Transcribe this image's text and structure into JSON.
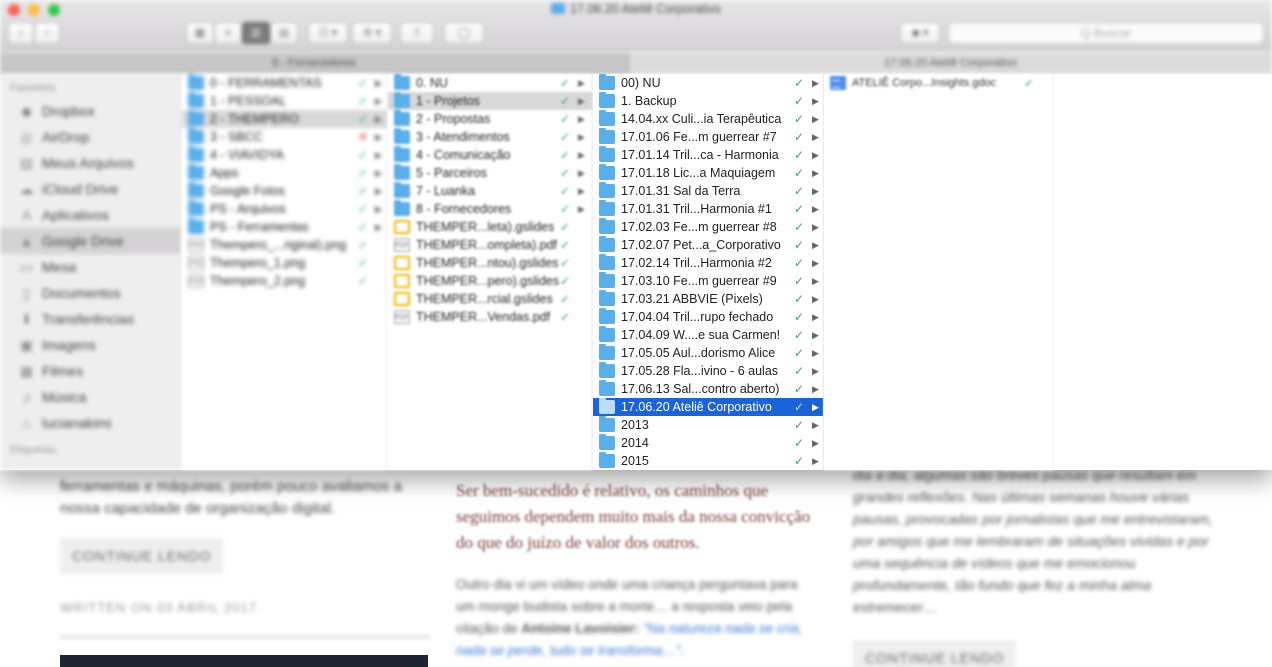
{
  "window": {
    "title": "17.06.20 Ateliê Corporativo"
  },
  "toolbar": {
    "back": "‹",
    "forward": "›",
    "view_icons": "▦",
    "view_list": "≡",
    "view_columns": "▥",
    "view_coverflow": "▤",
    "arrange": "☷ ▾",
    "action": "⚙ ▾",
    "share": "⇧",
    "tags": "◯",
    "dropbox": "◆ ▾",
    "search_placeholder": "Q Buscar"
  },
  "pathbar": {
    "left": "8 - Fornecedores",
    "right": "17.06.20 Ateliê Corporativo"
  },
  "sidebar": {
    "favorites_heading": "Favoritos",
    "tags_heading": "Etiquetas",
    "items": [
      {
        "label": "Dropbox",
        "icon": "dropbox-icon",
        "glyph": "◆"
      },
      {
        "label": "AirDrop",
        "icon": "airdrop-icon",
        "glyph": "◎"
      },
      {
        "label": "Meus Arquivos",
        "icon": "all-files-icon",
        "glyph": "▤"
      },
      {
        "label": "iCloud Drive",
        "icon": "cloud-icon",
        "glyph": "☁"
      },
      {
        "label": "Aplicativos",
        "icon": "applications-icon",
        "glyph": "A"
      },
      {
        "label": "Google Drive",
        "icon": "google-drive-icon",
        "glyph": "▲"
      },
      {
        "label": "Mesa",
        "icon": "desktop-icon",
        "glyph": "▭"
      },
      {
        "label": "Documentos",
        "icon": "documents-icon",
        "glyph": "▯"
      },
      {
        "label": "Transferências",
        "icon": "downloads-icon",
        "glyph": "⬇"
      },
      {
        "label": "Imagens",
        "icon": "pictures-icon",
        "glyph": "▣"
      },
      {
        "label": "Filmes",
        "icon": "movies-icon",
        "glyph": "▦"
      },
      {
        "label": "Música",
        "icon": "music-icon",
        "glyph": "♫"
      },
      {
        "label": "lucianakimi",
        "icon": "home-icon",
        "glyph": "⌂"
      }
    ]
  },
  "columns": {
    "col1": [
      {
        "label": "0 - FERRAMENTAS",
        "type": "folder",
        "status": "ok",
        "arrow": true
      },
      {
        "label": "1 - PESSOAL",
        "type": "folder",
        "status": "ok",
        "arrow": true
      },
      {
        "label": "2 - THEMPERO",
        "type": "folder",
        "status": "ok",
        "arrow": true
      },
      {
        "label": "3 - SBCC",
        "type": "folder",
        "status": "error",
        "arrow": true
      },
      {
        "label": "4 - VIAVIDYA",
        "type": "folder",
        "status": "ok",
        "arrow": true
      },
      {
        "label": "Apps",
        "type": "folder",
        "status": "ok",
        "arrow": true
      },
      {
        "label": "Google Fotos",
        "type": "folder",
        "status": "ok",
        "arrow": true
      },
      {
        "label": "PS - Arquivos",
        "type": "folder",
        "status": "ok",
        "arrow": true
      },
      {
        "label": "PS - Ferramentas",
        "type": "folder",
        "status": "ok",
        "arrow": true
      },
      {
        "label": "Thempero_...riginal).png",
        "type": "png",
        "status": "ok",
        "arrow": false
      },
      {
        "label": "Thempero_1.png",
        "type": "png",
        "status": "ok",
        "arrow": false
      },
      {
        "label": "Thempero_2.png",
        "type": "png",
        "status": "ok",
        "arrow": false
      }
    ],
    "col2": [
      {
        "label": "0. NU",
        "type": "folder",
        "status": "ok",
        "arrow": true
      },
      {
        "label": "1 - Projetos",
        "type": "folder",
        "status": "ok",
        "arrow": true
      },
      {
        "label": "2 - Propostas",
        "type": "folder",
        "status": "ok",
        "arrow": true
      },
      {
        "label": "3 - Atendimentos",
        "type": "folder",
        "status": "ok",
        "arrow": true
      },
      {
        "label": "4 - Comunicação",
        "type": "folder",
        "status": "ok",
        "arrow": true
      },
      {
        "label": "5 - Parceiros",
        "type": "folder",
        "status": "ok",
        "arrow": true
      },
      {
        "label": "7 - Luanka",
        "type": "folder",
        "status": "ok",
        "arrow": true
      },
      {
        "label": "8 - Fornecedores",
        "type": "folder",
        "status": "ok",
        "arrow": true
      },
      {
        "label": "THEMPER...leta).gslides",
        "type": "gslides",
        "status": "ok",
        "arrow": false
      },
      {
        "label": "THEMPER...ompleta).pdf",
        "type": "pdf",
        "status": "ok",
        "arrow": false
      },
      {
        "label": "THEMPER...ntou).gslides",
        "type": "gslides",
        "status": "ok",
        "arrow": false
      },
      {
        "label": "THEMPER...pero).gslides",
        "type": "gslides",
        "status": "ok",
        "arrow": false
      },
      {
        "label": "THEMPER...rcial.gslides",
        "type": "gslides",
        "status": "ok",
        "arrow": false
      },
      {
        "label": "THEMPER...Vendas.pdf",
        "type": "pdf",
        "status": "ok",
        "arrow": false
      }
    ],
    "col3": [
      {
        "label": "00) NU",
        "type": "folder",
        "status": "ok",
        "arrow": true
      },
      {
        "label": "1. Backup",
        "type": "folder",
        "status": "ok",
        "arrow": true
      },
      {
        "label": "14.04.xx Culi...ia Terapêutica",
        "type": "folder",
        "status": "ok",
        "arrow": true
      },
      {
        "label": "17.01.06 Fe...m guerrear #7",
        "type": "folder",
        "status": "ok",
        "arrow": true
      },
      {
        "label": "17.01.14 Tril...ca - Harmonia",
        "type": "folder",
        "status": "ok",
        "arrow": true
      },
      {
        "label": "17.01.18 Lic...a Maquiagem",
        "type": "folder",
        "status": "ok",
        "arrow": true
      },
      {
        "label": "17.01.31 Sal da Terra",
        "type": "folder",
        "status": "ok",
        "arrow": true
      },
      {
        "label": "17.01.31 Tril...Harmonia #1",
        "type": "folder",
        "status": "ok",
        "arrow": true
      },
      {
        "label": "17.02.03 Fe...m guerrear #8",
        "type": "folder",
        "status": "ok",
        "arrow": true
      },
      {
        "label": "17.02.07 Pet...a_Corporativo",
        "type": "folder",
        "status": "ok",
        "arrow": true
      },
      {
        "label": "17.02.14 Tril...Harmonia #2",
        "type": "folder",
        "status": "ok",
        "arrow": true
      },
      {
        "label": "17.03.10 Fe...m guerrear #9",
        "type": "folder",
        "status": "ok",
        "arrow": true
      },
      {
        "label": "17.03.21 ABBVIE (Pixels)",
        "type": "folder",
        "status": "ok",
        "arrow": true
      },
      {
        "label": "17.04.04 Tril...rupo fechado",
        "type": "folder",
        "status": "ok",
        "arrow": true
      },
      {
        "label": "17.04.09 W....e sua Carmen!",
        "type": "folder",
        "status": "ok",
        "arrow": true
      },
      {
        "label": "17.05.05 Aul...dorismo Alice",
        "type": "folder",
        "status": "ok",
        "arrow": true
      },
      {
        "label": "17.05.28 Fla...ivino - 6 aulas",
        "type": "folder",
        "status": "ok",
        "arrow": true
      },
      {
        "label": "17.06.13 Sal...contro aberto)",
        "type": "folder",
        "status": "ok",
        "arrow": true
      },
      {
        "label": "17.06.20 Ateliê Corporativo",
        "type": "folder",
        "status": "ok",
        "arrow": true
      },
      {
        "label": "2013",
        "type": "folder",
        "status": "ok",
        "arrow": true
      },
      {
        "label": "2014",
        "type": "folder",
        "status": "ok",
        "arrow": true
      },
      {
        "label": "2015",
        "type": "folder",
        "status": "ok",
        "arrow": true
      }
    ],
    "col4": [
      {
        "label": "ATELIÊ Corpo...Insights.gdoc",
        "type": "gdoc",
        "status": "ok",
        "arrow": false
      }
    ]
  },
  "selection": {
    "col1": 2,
    "col2": 1,
    "col3": 18
  },
  "colors": {
    "selection_blue": "#1a63d8",
    "check_green": "#37a456",
    "error_red": "#e03a3a",
    "folder_blue": "#5aaeea"
  },
  "background_page": {
    "left_excerpt": "ferramentas e máquinas, porém pouco avaliamos a nossa capacidade de organização digital.",
    "left_button": "CONTINUE LENDO",
    "left_written": "WRITTEN ON 03 ABRIL 2017.",
    "mid_quote": "Ser bem-sucedido é relativo, os caminhos que seguimos dependem muito mais da nossa convicção do que do juízo de valor dos outros.",
    "mid_text_a": "Outro dia vi um vídeo onde uma criança perguntava para um monge budista sobre a morte… a resposta veio pela citação de",
    "mid_author": "Antoine Lavoisier:",
    "mid_text_b": "\"Na natureza nada se cria, nada se perde, tudo se transforma…\".",
    "right_text": "dia a dia, algumas são breves pausas que resultam em grandes reflexões. Nas últimas semanas houve várias pausas, provocadas por jornalistas que me entrevistaram, por amigos que me lembraram de situações vividas e por uma sequência de vídeos que me emocionou profundamente, tão fundo que fez a minha alma estremecer…",
    "right_button": "CONTINUE LENDO"
  }
}
